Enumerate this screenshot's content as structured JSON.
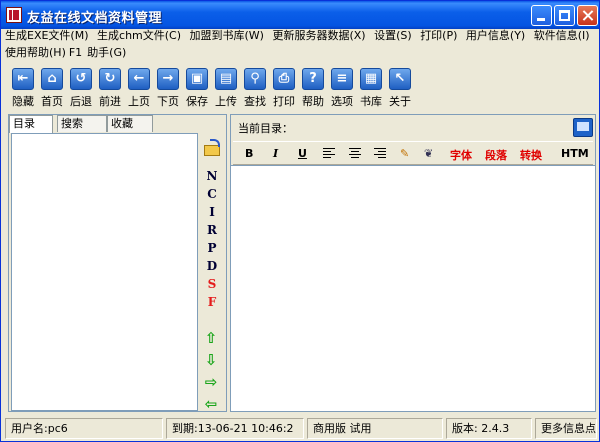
{
  "window": {
    "title": "友益在线文档资料管理"
  },
  "menu": {
    "row1": [
      "生成EXE文件(M)",
      "生成chm文件(C)",
      "加盟到书库(W)",
      "更新服务器数据(X)",
      "设置(S)",
      "打印(P)",
      "用户信息(Y)",
      "软件信息(I)"
    ],
    "row2": [
      "使用帮助(H)",
      "F1",
      "助手(G)"
    ]
  },
  "toolbar": {
    "items": [
      {
        "label": "隐藏",
        "icon": "hide-icon",
        "glyph": "⇤"
      },
      {
        "label": "首页",
        "icon": "home-icon",
        "glyph": "⌂"
      },
      {
        "label": "后退",
        "icon": "undo-icon",
        "glyph": "↺"
      },
      {
        "label": "前进",
        "icon": "redo-icon",
        "glyph": "↻"
      },
      {
        "label": "上页",
        "icon": "arrow-left-icon",
        "glyph": "←"
      },
      {
        "label": "下页",
        "icon": "arrow-right-icon",
        "glyph": "→"
      },
      {
        "label": "保存",
        "icon": "save-icon",
        "glyph": "▣"
      },
      {
        "label": "上传",
        "icon": "upload-icon",
        "glyph": "▤"
      },
      {
        "label": "查找",
        "icon": "search-icon",
        "glyph": "⚲"
      },
      {
        "label": "打印",
        "icon": "print-icon",
        "glyph": "⎙"
      },
      {
        "label": "帮助",
        "icon": "help-icon",
        "glyph": "?"
      },
      {
        "label": "选项",
        "icon": "options-icon",
        "glyph": "≡"
      },
      {
        "label": "书库",
        "icon": "library-icon",
        "glyph": "▦"
      },
      {
        "label": "关于",
        "icon": "about-icon",
        "glyph": "↖"
      }
    ]
  },
  "left": {
    "tabs": [
      "目录",
      "搜索",
      "收藏"
    ],
    "side_letters": [
      "N",
      "C",
      "I",
      "R",
      "P",
      "D",
      "S",
      "F"
    ],
    "red_letters": [
      "S",
      "F"
    ],
    "arrows": [
      "⇧",
      "⇩",
      "⇨",
      "⇦"
    ]
  },
  "right": {
    "current_dir_label": "当前目录：",
    "format": {
      "bold": "B",
      "italic": "I",
      "underline": "U",
      "font": "字体",
      "paragraph": "段落",
      "convert": "转换",
      "html": "HTM"
    }
  },
  "status": {
    "user": "用户名:pc6",
    "expiry": "到期:13-06-21 10:46:2",
    "edition": "商用版 试用",
    "version": "版本: 2.4.3",
    "more": "更多信息点"
  }
}
